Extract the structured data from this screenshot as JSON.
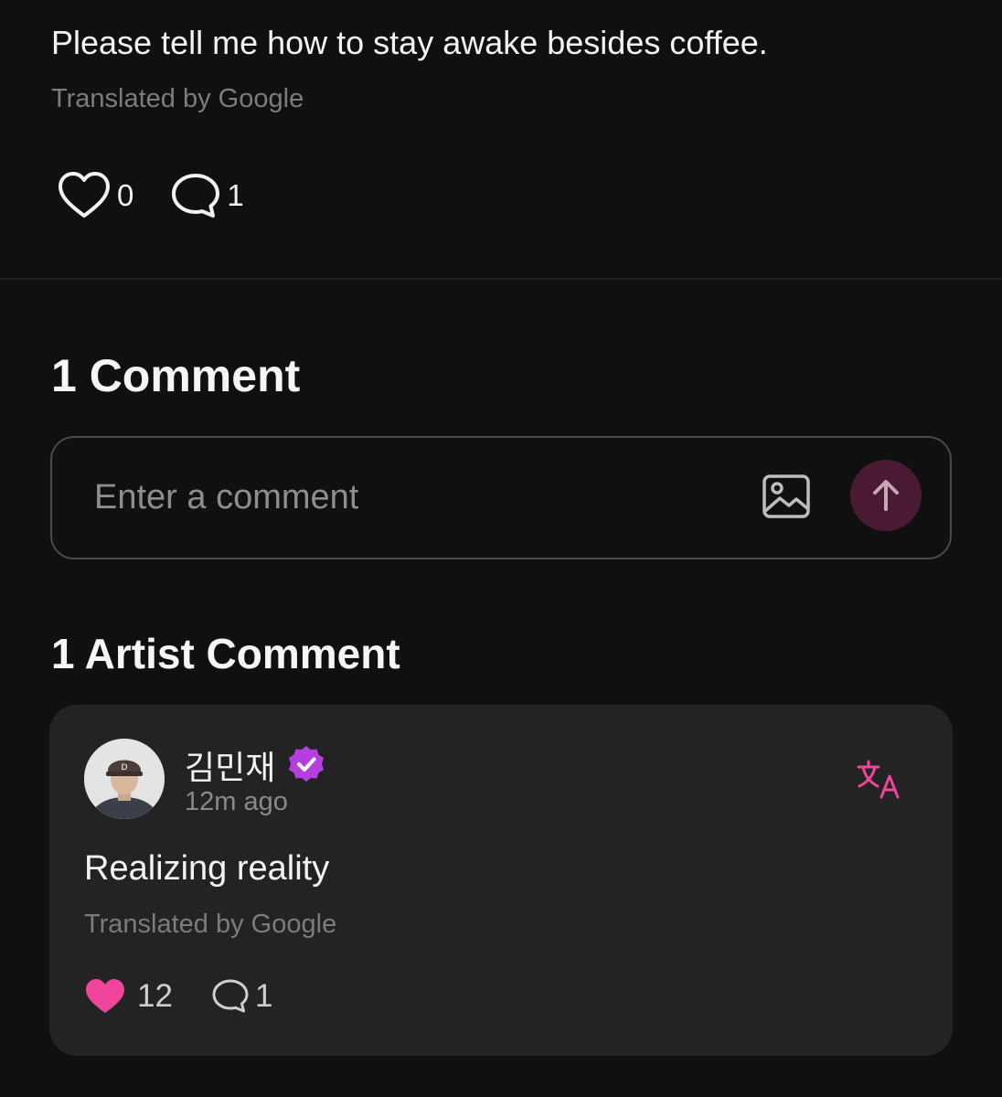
{
  "post": {
    "text": "Please tell me how to stay awake besides coffee.",
    "translated_note": "Translated by Google",
    "like_count": "0",
    "comment_count": "1",
    "like_icon": "heart-outline-icon",
    "comment_icon": "speech-bubble-icon"
  },
  "comments": {
    "title": "1 Comment",
    "input": {
      "placeholder": "Enter a comment",
      "image_icon": "image-icon",
      "send_icon": "arrow-up-icon"
    }
  },
  "artist_comments": {
    "title": "1 Artist Comment",
    "items": [
      {
        "author": "김민재",
        "verified_icon": "verified-badge-icon",
        "timestamp": "12m ago",
        "text": "Realizing reality",
        "translated_note": "Translated by Google",
        "like_count": "12",
        "reply_count": "1",
        "translate_icon": "translate-icon",
        "like_icon": "heart-filled-icon"
      }
    ]
  },
  "colors": {
    "background": "#101010",
    "card": "#232323",
    "accent_pink": "#f0459d",
    "verified_purple": "#b43ee0",
    "send_button": "#4a1a33"
  }
}
